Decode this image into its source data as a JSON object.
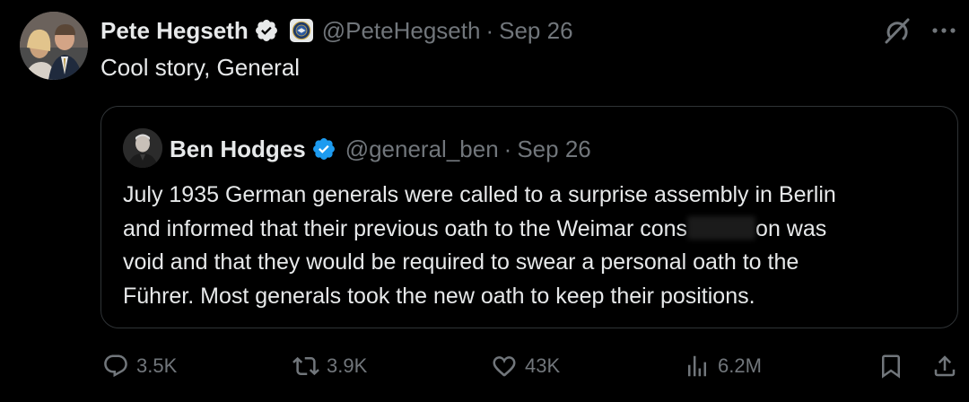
{
  "post": {
    "author": {
      "name": "Pete Hegseth",
      "handle": "@PeteHegseth",
      "verified_icon": "verified-badge-icon",
      "org_icon": "department-seal-icon"
    },
    "separator": "·",
    "date": "Sep 26",
    "text": "Cool story, General"
  },
  "quote": {
    "author": {
      "name": "Ben Hodges",
      "handle": "@general_ben",
      "verified_icon": "verified-badge-icon"
    },
    "separator": "·",
    "date": "Sep 26",
    "lines": [
      "July 1935 German generals were called to a surprise assembly in Berlin",
      "and informed that their previous oath to the Weimar cons",
      "on was",
      "void and that they would be required to swear a personal oath to the",
      "Führer. Most generals took the new oath to keep their positions."
    ]
  },
  "actions": {
    "replies": "3.5K",
    "reposts": "3.9K",
    "likes": "43K",
    "views": "6.2M"
  },
  "colors": {
    "background": "#000000",
    "text": "#e7e9ea",
    "muted": "#71767b",
    "border": "#2f3336",
    "verified": "#1d9bf0"
  }
}
